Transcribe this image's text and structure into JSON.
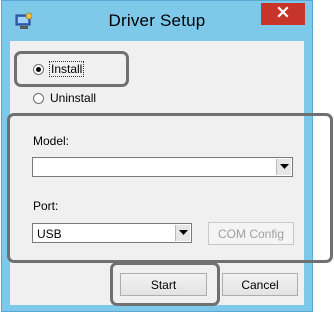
{
  "window": {
    "title": "Driver Setup",
    "icon": "app-setup-icon",
    "close_icon": "close-icon"
  },
  "radios": [
    {
      "label": "Install",
      "checked": true
    },
    {
      "label": "Uninstall",
      "checked": false
    }
  ],
  "model": {
    "label": "Model:",
    "value": ""
  },
  "port": {
    "label": "Port:",
    "value": "USB"
  },
  "buttons": {
    "com_config": "COM Config",
    "start": "Start",
    "cancel": "Cancel"
  },
  "colors": {
    "frame": "#7ec8ea",
    "close": "#c7342a",
    "highlight": "#707070"
  }
}
